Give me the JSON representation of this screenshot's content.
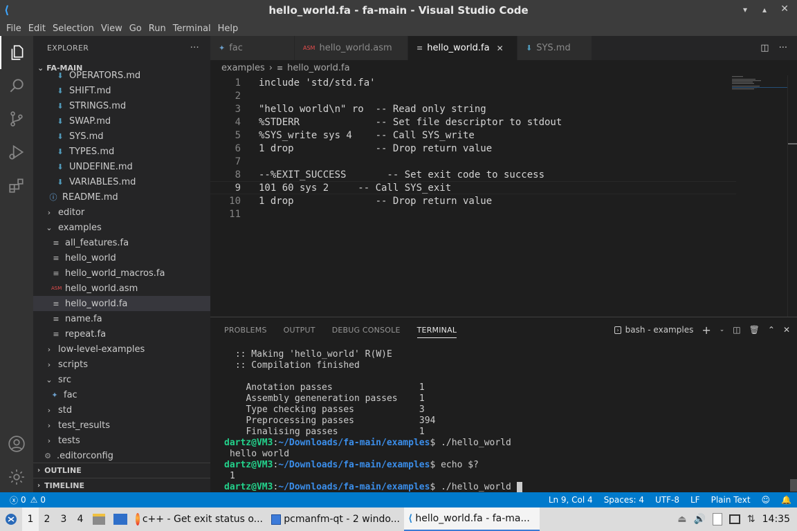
{
  "window": {
    "title": "hello_world.fa - fa-main - Visual Studio Code"
  },
  "menu": [
    "File",
    "Edit",
    "Selection",
    "View",
    "Go",
    "Run",
    "Terminal",
    "Help"
  ],
  "explorer": {
    "header": "EXPLORER",
    "more": "···",
    "root": "FA-MAIN",
    "items": [
      {
        "label": "OPERATORS.md",
        "icon": "markdown-icon",
        "indent": 32
      },
      {
        "label": "SHIFT.md",
        "icon": "markdown-icon",
        "indent": 32
      },
      {
        "label": "STRINGS.md",
        "icon": "markdown-icon",
        "indent": 32
      },
      {
        "label": "SWAP.md",
        "icon": "markdown-icon",
        "indent": 32
      },
      {
        "label": "SYS.md",
        "icon": "markdown-icon",
        "indent": 32
      },
      {
        "label": "TYPES.md",
        "icon": "markdown-icon",
        "indent": 32
      },
      {
        "label": "UNDEFINE.md",
        "icon": "markdown-icon",
        "indent": 32
      },
      {
        "label": "VARIABLES.md",
        "icon": "markdown-icon",
        "indent": 32
      },
      {
        "label": "README.md",
        "icon": "info-icon",
        "indent": 22
      },
      {
        "label": "editor",
        "icon": "chevron-right-icon",
        "indent": 16
      },
      {
        "label": "examples",
        "icon": "chevron-down-icon",
        "indent": 16
      },
      {
        "label": "all_features.fa",
        "icon": "text-file-icon",
        "indent": 26
      },
      {
        "label": "hello_world",
        "icon": "text-file-icon",
        "indent": 26
      },
      {
        "label": "hello_world_macros.fa",
        "icon": "text-file-icon",
        "indent": 26
      },
      {
        "label": "hello_world.asm",
        "icon": "asm-icon",
        "indent": 26
      },
      {
        "label": "hello_world.fa",
        "icon": "text-file-icon",
        "indent": 26,
        "selected": true
      },
      {
        "label": "name.fa",
        "icon": "text-file-icon",
        "indent": 26
      },
      {
        "label": "repeat.fa",
        "icon": "text-file-icon",
        "indent": 26
      },
      {
        "label": "low-level-examples",
        "icon": "chevron-right-icon",
        "indent": 16
      },
      {
        "label": "scripts",
        "icon": "chevron-right-icon",
        "indent": 16
      },
      {
        "label": "src",
        "icon": "chevron-down-icon",
        "indent": 16
      },
      {
        "label": "fac",
        "icon": "python-icon",
        "indent": 24
      },
      {
        "label": "std",
        "icon": "chevron-right-icon",
        "indent": 16
      },
      {
        "label": "test_results",
        "icon": "chevron-right-icon",
        "indent": 16
      },
      {
        "label": "tests",
        "icon": "chevron-right-icon",
        "indent": 16
      },
      {
        "label": ".editorconfig",
        "icon": "gear-icon",
        "indent": 14
      }
    ],
    "outline": "OUTLINE",
    "timeline": "TIMELINE"
  },
  "tabs": [
    {
      "label": "fac",
      "icon": "python-icon",
      "active": false
    },
    {
      "label": "hello_world.asm",
      "icon": "asm-icon",
      "active": false
    },
    {
      "label": "hello_world.fa",
      "icon": "text-file-icon",
      "active": true
    },
    {
      "label": "SYS.md",
      "icon": "markdown-icon",
      "active": false
    }
  ],
  "breadcrumb": {
    "folder": "examples",
    "sep": "›",
    "file": "hello_world.fa"
  },
  "editor": {
    "current_line": 9,
    "lines": [
      "include 'std/std.fa'",
      "",
      "\"hello world\\n\" ro  -- Read only string",
      "%STDERR             -- Set file descriptor to stdout",
      "%SYS_write sys 4    -- Call SYS_write",
      "1 drop              -- Drop return value",
      "",
      "--%EXIT_SUCCESS       -- Set exit code to success",
      "101 60 sys 2     -- Call SYS_exit",
      "1 drop              -- Drop return value",
      ""
    ]
  },
  "panel": {
    "tabs": [
      "PROBLEMS",
      "OUTPUT",
      "DEBUG CONSOLE",
      "TERMINAL"
    ],
    "active_tab": "TERMINAL",
    "terminal_name": "bash - examples",
    "terminal_lines": [
      {
        "type": "text",
        "text": " :: Making 'hello_world' R(W)E"
      },
      {
        "type": "text",
        "text": " :: Compilation finished"
      },
      {
        "type": "text",
        "text": ""
      },
      {
        "type": "text",
        "text": "   Anotation passes                1"
      },
      {
        "type": "text",
        "text": "   Assembly geneneration passes    1"
      },
      {
        "type": "text",
        "text": "   Type checking passes            3"
      },
      {
        "type": "text",
        "text": "   Preprocessing passes            394"
      },
      {
        "type": "text",
        "text": "   Finalising passes               1"
      },
      {
        "type": "prompt",
        "user": "dartz@VM3",
        "path": "~/Downloads/fa-main/examples",
        "cmd": "./hello_world"
      },
      {
        "type": "text",
        "text": "hello world"
      },
      {
        "type": "prompt",
        "user": "dartz@VM3",
        "path": "~/Downloads/fa-main/examples",
        "cmd": "echo $?"
      },
      {
        "type": "text",
        "text": "1"
      },
      {
        "type": "prompt",
        "user": "dartz@VM3",
        "path": "~/Downloads/fa-main/examples",
        "cmd": "./hello_world",
        "cursor": true
      }
    ]
  },
  "status": {
    "errors": "0",
    "warnings": "0",
    "position": "Ln 9, Col 4",
    "spaces": "Spaces: 4",
    "encoding": "UTF-8",
    "eol": "LF",
    "language": "Plain Text"
  },
  "taskbar": {
    "workspaces": [
      "1",
      "2",
      "3",
      "4"
    ],
    "active_workspace": "1",
    "windows": [
      {
        "label": "c++ - Get exit status o...",
        "icon": "firefox-icon"
      },
      {
        "label": "pcmanfm-qt - 2 windo...",
        "icon": "folder-icon"
      },
      {
        "label": "hello_world.fa - fa-ma...",
        "icon": "vscode-icon",
        "active": true
      }
    ],
    "clock": "14:35"
  }
}
